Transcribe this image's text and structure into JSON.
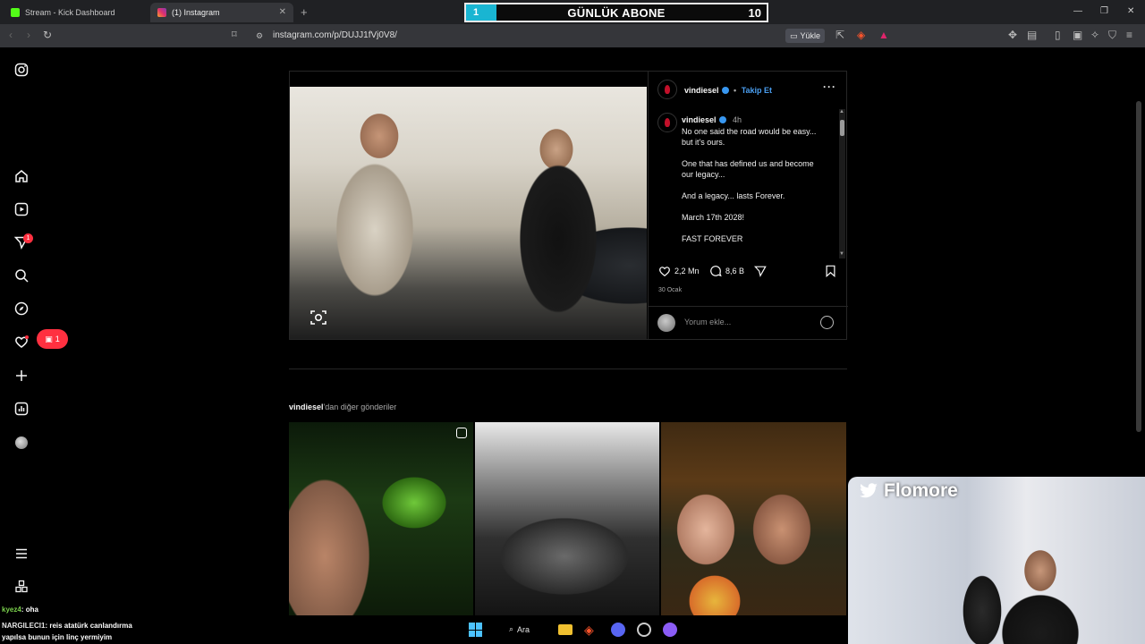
{
  "browser": {
    "tabs": [
      {
        "label": "Stream - Kick Dashboard",
        "favicon_color": "#53fc18"
      },
      {
        "label": "(1) Instagram",
        "favicon_color": "#e1306c"
      }
    ],
    "url": "instagram.com/p/DUJJ1fVj0V8/",
    "yukle_label": "Yükle"
  },
  "subscriber_bar": {
    "left_value": "1",
    "title": "GÜNLÜK ABONE",
    "goal": "10",
    "progress_fraction": 0.1,
    "accent": "#19b5d2"
  },
  "sidebar": {
    "items": [
      "instagram-logo",
      "home-icon",
      "reels-icon",
      "messages-icon",
      "search-icon",
      "explore-icon",
      "notifications-icon",
      "create-icon",
      "dashboard-icon",
      "profile-avatar",
      "menu-icon",
      "apps-icon"
    ],
    "messages_badge": "1",
    "activity_badge": "1"
  },
  "post": {
    "username": "vindiesel",
    "follow_label": "Takip Et",
    "separator": "•",
    "caption_time": "4h",
    "caption_lines": [
      "No one said the road would be easy... but it's ours.",
      "One that has defined us and become our legacy...",
      "And a legacy... lasts Forever.",
      "March 17th 2028!",
      "FAST FOREVER"
    ],
    "likes": "2,2 Mn",
    "comments": "8,6 B",
    "date": "30 Ocak",
    "comment_placeholder": "Yorum ekle..."
  },
  "more_posts": {
    "username": "vindiesel",
    "suffix": "'dan diğer gönderiler"
  },
  "webcam": {
    "name": "Flomore"
  },
  "chat": [
    {
      "user": "kyez4",
      "message": "oha"
    },
    {
      "user": "NARGILECI1",
      "message": "reis atatürk canlandırma yapılsa bunun için linç yermiyim"
    }
  ],
  "taskbar": {
    "search_label": "Ara"
  }
}
